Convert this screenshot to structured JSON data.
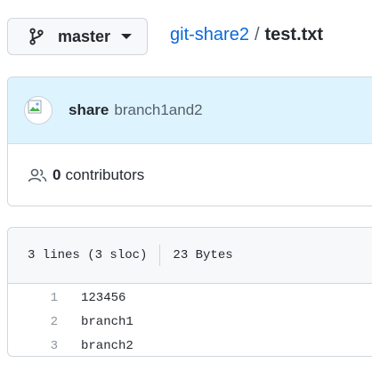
{
  "branch": {
    "icon": "git-branch-icon",
    "name": "master"
  },
  "breadcrumb": {
    "repo": "git-share2",
    "separator": "/",
    "file": "test.txt"
  },
  "commit": {
    "avatar_icon": "broken-image-icon",
    "author": "share",
    "message": "branch1and2"
  },
  "contributors": {
    "icon": "people-icon",
    "count": "0",
    "label": "contributors"
  },
  "file_info": {
    "lines": "3 lines (3 sloc)",
    "size": "23 Bytes"
  },
  "code_lines": [
    {
      "num": "1",
      "text": "123456"
    },
    {
      "num": "2",
      "text": "branch1"
    },
    {
      "num": "3",
      "text": "branch2"
    }
  ],
  "colors": {
    "link": "#0969da",
    "commit_header_bg": "#ddf4ff",
    "border": "#d0d7de"
  }
}
